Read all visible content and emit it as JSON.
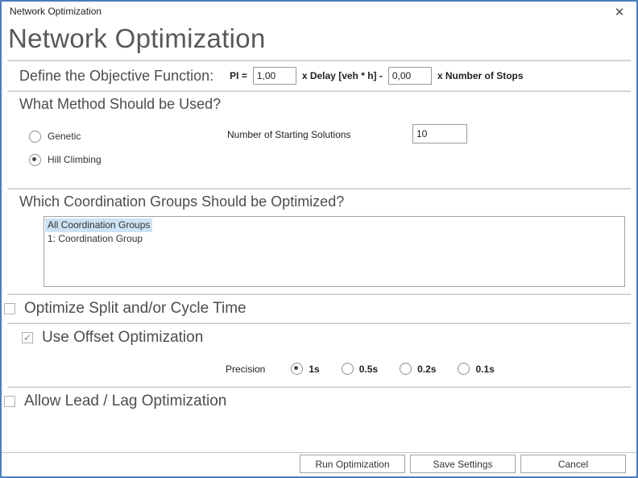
{
  "window": {
    "title": "Network Optimization"
  },
  "icons": {
    "close": "✕",
    "check": "✓"
  },
  "header": {
    "title": "Network Optimization"
  },
  "objective": {
    "heading": "Define the Objective Function:",
    "pi_label": "PI =",
    "delay_value": "1,00",
    "delay_label": "x Delay [veh * h] -",
    "stops_value": "0,00",
    "stops_label": "x Number of Stops"
  },
  "method": {
    "heading": "What Method Should be Used?",
    "options": [
      {
        "label": "Genetic",
        "selected": false
      },
      {
        "label": "Hill Climbing",
        "selected": true
      }
    ],
    "starting_solutions_label": "Number of Starting Solutions",
    "starting_solutions_value": "10"
  },
  "coordination": {
    "heading": "Which Coordination Groups Should be Optimized?",
    "items": [
      {
        "label": "All Coordination Groups",
        "selected": true
      },
      {
        "label": "1: Coordination Group",
        "selected": false
      }
    ]
  },
  "split_cycle": {
    "label": "Optimize Split and/or Cycle Time",
    "checked": false
  },
  "offset": {
    "label": "Use Offset Optimization",
    "checked": true,
    "precision_label": "Precision",
    "precision_options": [
      {
        "label": "1s",
        "selected": true
      },
      {
        "label": "0.5s",
        "selected": false
      },
      {
        "label": "0.2s",
        "selected": false
      },
      {
        "label": "0.1s",
        "selected": false
      }
    ]
  },
  "lead_lag": {
    "label": "Allow Lead / Lag Optimization",
    "checked": false
  },
  "footer": {
    "buttons": [
      "Run Optimization",
      "Save Settings",
      "Cancel"
    ]
  },
  "colors": {
    "window_border": "#4a7ebb",
    "selection_bg": "#cbe3f5"
  }
}
